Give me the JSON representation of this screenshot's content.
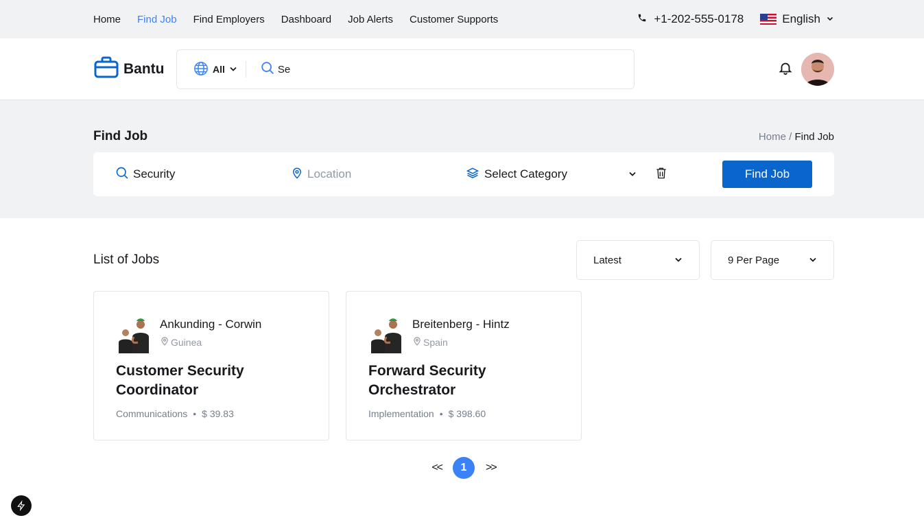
{
  "topnav": {
    "links": [
      "Home",
      "Find Job",
      "Find Employers",
      "Dashboard",
      "Job Alerts",
      "Customer Supports"
    ],
    "active": "Find Job",
    "phone": "+1-202-555-0178",
    "language": "English"
  },
  "header": {
    "brand": "Bantu",
    "country_filter": "All",
    "search_value": "Se"
  },
  "page": {
    "title": "Find Job",
    "breadcrumb_home": "Home",
    "breadcrumb_sep": "/",
    "breadcrumb_current": "Find Job"
  },
  "filters": {
    "keyword": "Security",
    "location_placeholder": "Location",
    "category": "Select Category",
    "button": "Find Job"
  },
  "list": {
    "title": "List of Jobs",
    "sort": "Latest",
    "per_page": "9 Per Page"
  },
  "jobs": [
    {
      "company": "Ankunding - Corwin",
      "country": "Guinea",
      "title": "Customer Security Coordinator",
      "category": "Communications",
      "salary": "$ 39.83"
    },
    {
      "company": "Breitenberg - Hintz",
      "country": "Spain",
      "title": "Forward Security Orchestrator",
      "category": "Implementation",
      "salary": "$ 398.60"
    }
  ],
  "pagination": {
    "prev": "<<",
    "current": "1",
    "next": ">>"
  },
  "colors": {
    "accent": "#3b82f6",
    "primary_button": "#0a65cc",
    "band": "#f1f2f4"
  }
}
